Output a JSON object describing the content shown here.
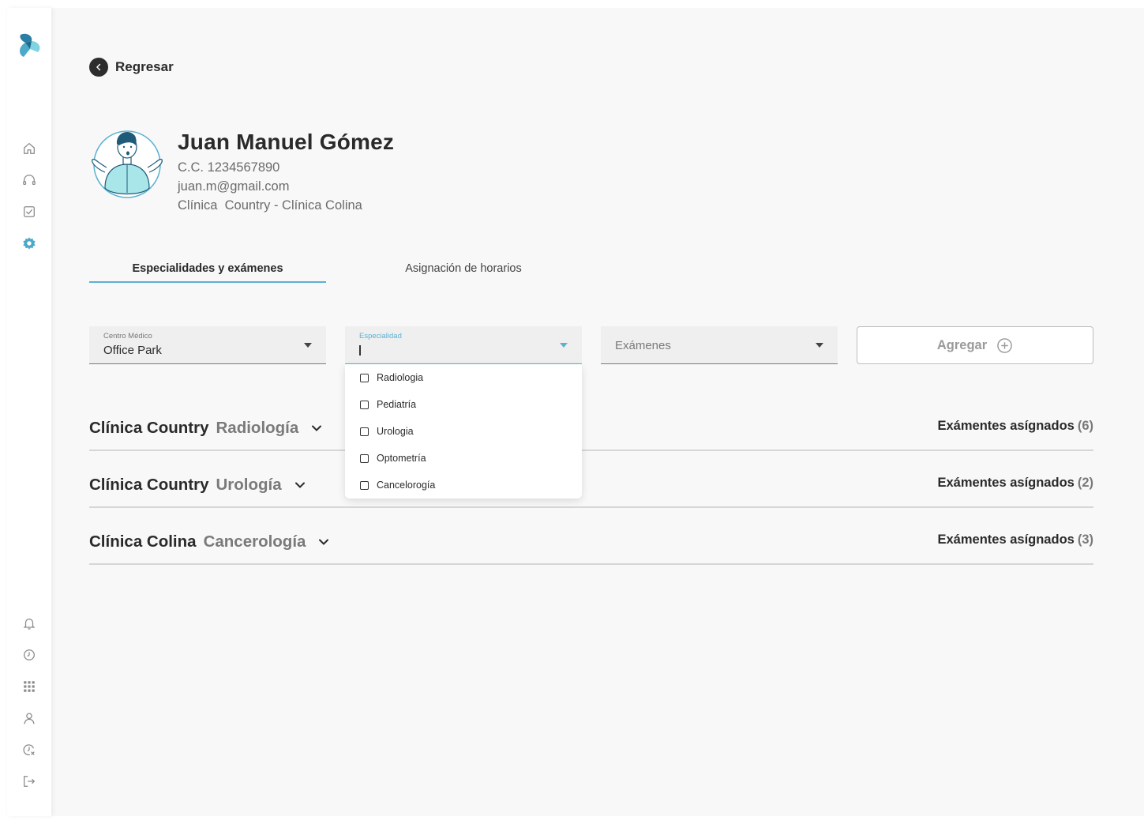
{
  "nav": {
    "back_label": "Regresar",
    "top_icons": [
      "home-icon",
      "headset-icon",
      "checkbox-icon",
      "gear-icon"
    ],
    "bottom_icons": [
      "bell-icon",
      "clock-icon",
      "apps-grid-icon",
      "user-icon",
      "clock-cancel-icon",
      "logout-icon"
    ],
    "active_color": "#4ba9c9"
  },
  "profile": {
    "name": "Juan Manuel Gómez",
    "document": "C.C. 1234567890",
    "email": "juan.m@gmail.com",
    "clinics": "Clínica  Country - Clínica Colina"
  },
  "tabs": [
    {
      "label": "Especialidades y exámenes",
      "active": true
    },
    {
      "label": "Asignación de horarios",
      "active": false
    }
  ],
  "filters": {
    "centro_medico": {
      "label": "Centro Médico",
      "value": "Office Park"
    },
    "especialidad": {
      "label": "Especialidad",
      "value": ""
    },
    "examenes": {
      "placeholder": "Exámenes"
    },
    "add_button": "Agregar"
  },
  "dropdown": {
    "options": [
      "Radiologia",
      "Pediatría",
      "Urologia",
      "Optometría",
      "Cancelorogía"
    ]
  },
  "assignments": [
    {
      "clinic": "Clínica Country",
      "specialty": "Radiología",
      "label": "Exámentes asígnados",
      "count": "(6)"
    },
    {
      "clinic": "Clínica Country",
      "specialty": "Urología",
      "label": "Exámentes asígnados",
      "count": "(2)"
    },
    {
      "clinic": "Clínica Colina",
      "specialty": "Cancerología",
      "label": "Exámentes asígnados",
      "count": "(3)"
    }
  ],
  "colors": {
    "accent": "#5cb1d2",
    "logo_dark": "#2a7fa5",
    "logo_light": "#7fd3e3"
  }
}
